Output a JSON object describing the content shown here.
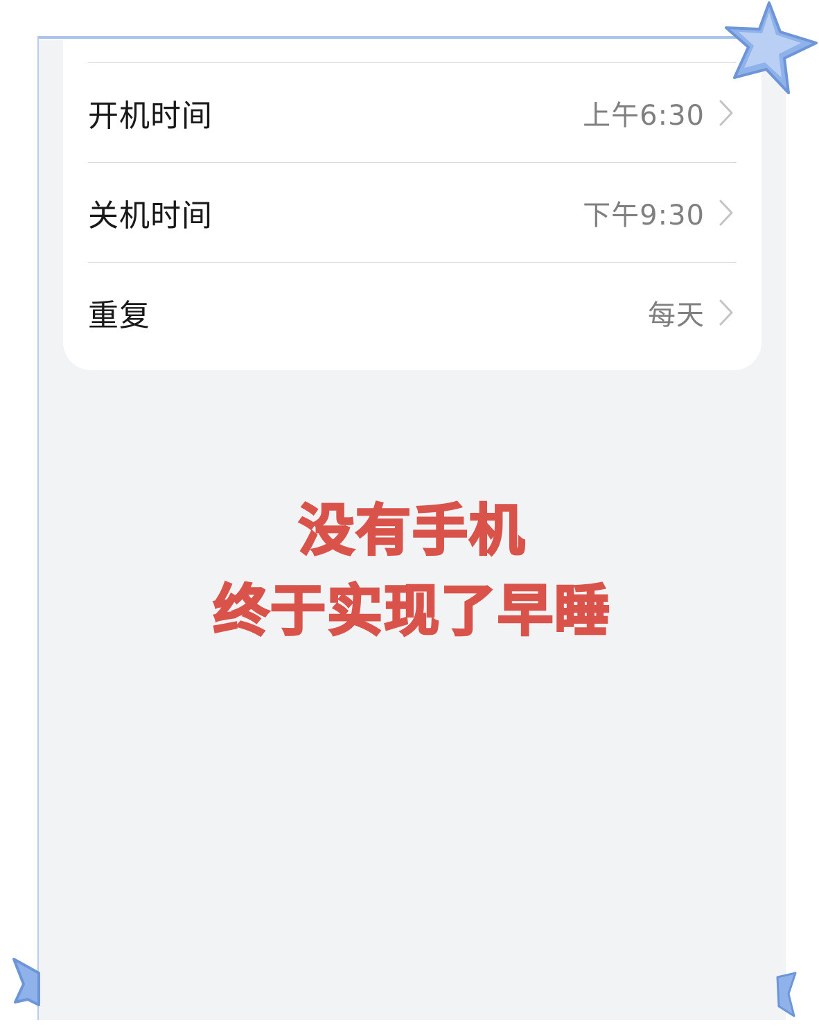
{
  "settings": {
    "rows": [
      {
        "label": "开机时间",
        "value": "上午6:30"
      },
      {
        "label": "关机时间",
        "value": "下午9:30"
      },
      {
        "label": "重复",
        "value": "每天"
      }
    ]
  },
  "headline": {
    "line1": "没有手机",
    "line2": "终于实现了早睡"
  },
  "colors": {
    "background": "#f1f3f5",
    "card": "#ffffff",
    "headline": "#d9534a",
    "star": "#7fa6e3",
    "frame": "#a9c3ea"
  },
  "icons": {
    "chevron": "chevron-right-icon",
    "decoration": "star-icon"
  }
}
